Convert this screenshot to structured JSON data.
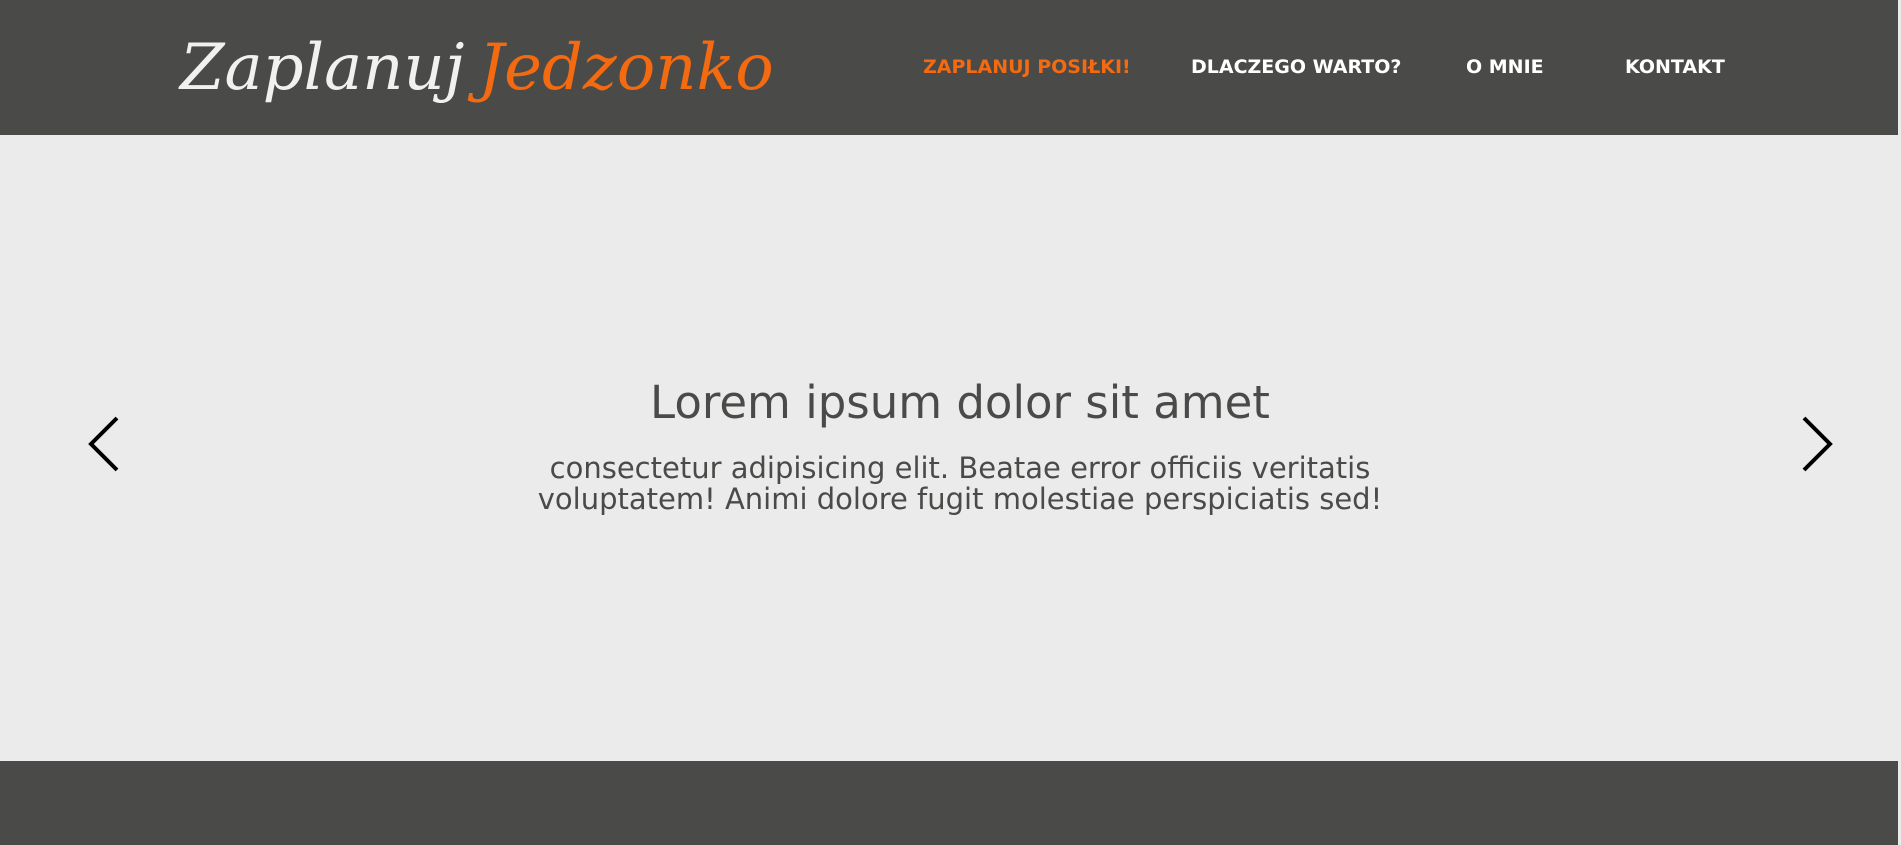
{
  "header": {
    "logo_part_1": "Zaplanuj",
    "logo_part_2": "Jedzonko",
    "nav": [
      {
        "label": "ZAPLANUJ POSIŁKI!",
        "active": true
      },
      {
        "label": "DLACZEGO WARTO?",
        "active": false
      },
      {
        "label": "O MNIE",
        "active": false
      },
      {
        "label": "KONTAKT",
        "active": false
      }
    ]
  },
  "hero": {
    "title": "Lorem ipsum dolor sit amet",
    "text": "consectetur adipisicing elit. Beatae error officiis veritatis voluptatem! Animi dolore fugit molestiae perspiciatis sed!",
    "prev_icon": "chevron-left-icon",
    "next_icon": "chevron-right-icon"
  },
  "colors": {
    "header_bg": "#4a4a48",
    "accent": "#f36a10",
    "hero_bg": "#ebebeb",
    "text": "#4a4a48"
  }
}
